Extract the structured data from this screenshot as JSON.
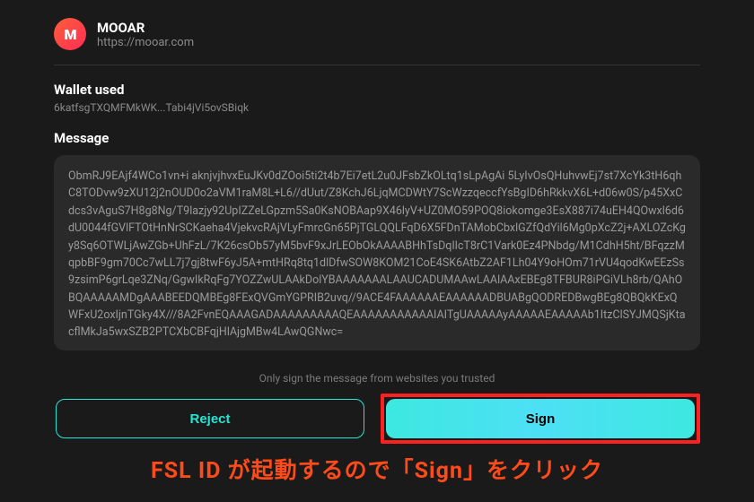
{
  "header": {
    "logo_letter": "M",
    "app_name": "MOOAR",
    "app_url": "https://mooar.com"
  },
  "wallet": {
    "label": "Wallet used",
    "address": "6katfsgTXQMFMkWK...Tabi4jVi5ovSBiqk"
  },
  "message": {
    "label": "Message",
    "body": "ObmRJ9EAjf4WCo1vn+i aknjvjhvxEuJKv0dZOoi5ti2t4b7Ei7etL2u0JFsbZkOLtq1sLpAgAi 5LyIvOsQHuhvwEj7st7XcYk3tH6qhC8TODvw9zXU12j2nOUD0o2aVM1raM8L+L6//dUut/Z8KchJ6LjqMCDWtY7ScWzzqeccfYsBgID6hRkkvX6L+d06w0S/p45XxCdcs3vAguS7H8g8Ng/T9lazjy92UpIZZeLGpzm5Sa0KsNOBAap9X46lyV+UZ0MO59POQ8iokomge3EsX887i74uEH4QOwxl6d6dU0044fGVlFTOtHnNrSCKaeha4VjekvcRAjVLyFmrcGn65PjTGLQQLFqD6X5FDnTAMobCbxlGZfQdYil6Mg0pXcZ2j+AXLOZcKgy8Sq6OTWLjAwZGb+UhFzL/7K26csOb57yM5bvF9xJrLEObOkAAAABHhTsDqIlcT8rC1Vark0Ez4PNbdg/M1CdhH5ht/BFqzzMqpbBF9gm70Cc7wLL7j7gj8twF6yJ5A+mtHRq8tq1dlDfwSOW8KOM21CoE4SK6AtbZ2AF1Lh04Y9oHOm71rVU4qodKwEEzSs9zsimP6grLqe3ZNq/GgwIkRqFg7YOZZwULAAkDolYBAAAAAAALAAUCADUMAAwLAAlAAxEBEg8TFBUR8iPGiVLh8rb/QAhOBQAAAAAMDgAAABEEDQMBEg8FExQVGmYGPRIB2uvq//9ACE4FAAAAAAEAAAAAADBUABgQODREDBwgBEg8QBQkKExQWFxU2oxIjnTGky4X///8A2FvnEQAAAGADAAAAAAAAAQEAAAAAAAAAAAIAITgUAAAAAyAAAAAEAAAAAb1ItzClSYJMQSjKtacflMkJa5wxSZB2PTCXbCBFqjHlAjgMBw4LAwQGNwc="
  },
  "notice": "Only sign the message from websites you trusted",
  "buttons": {
    "reject": "Reject",
    "sign": "Sign"
  },
  "annotation": "FSL ID が起動するので「Sign」をクリック"
}
